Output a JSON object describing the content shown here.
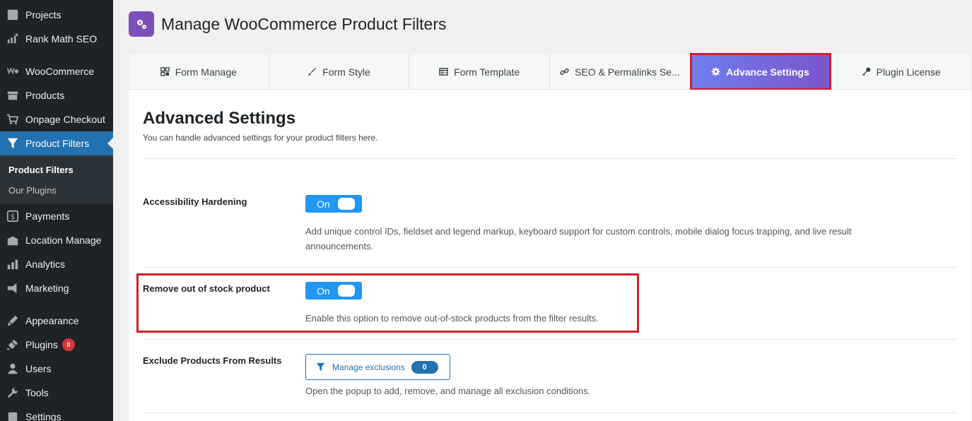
{
  "sidebar": {
    "items": [
      {
        "label": "Projects",
        "icon": "projects-icon"
      },
      {
        "label": "Rank Math SEO",
        "icon": "rank-math-icon"
      },
      {
        "label": "WooCommerce",
        "icon": "woocommerce-icon"
      },
      {
        "label": "Products",
        "icon": "products-icon"
      },
      {
        "label": "Onpage Checkout",
        "icon": "cart-icon"
      },
      {
        "label": "Product Filters",
        "icon": "filter-icon"
      },
      {
        "label": "Payments",
        "icon": "payments-icon"
      },
      {
        "label": "Location Manage",
        "icon": "location-icon"
      },
      {
        "label": "Analytics",
        "icon": "analytics-icon"
      },
      {
        "label": "Marketing",
        "icon": "marketing-icon"
      },
      {
        "label": "Appearance",
        "icon": "appearance-icon"
      },
      {
        "label": "Plugins",
        "icon": "plugins-icon"
      },
      {
        "label": "Users",
        "icon": "users-icon"
      },
      {
        "label": "Tools",
        "icon": "tools-icon"
      },
      {
        "label": "Settings",
        "icon": "settings-icon"
      }
    ],
    "submenu": [
      "Product Filters",
      "Our Plugins"
    ],
    "plugins_badge": "8"
  },
  "header": {
    "title": "Manage WooCommerce Product Filters"
  },
  "tabs": [
    {
      "label": "Form Manage",
      "icon": "grid-icon"
    },
    {
      "label": "Form Style",
      "icon": "brush-icon"
    },
    {
      "label": "Form Template",
      "icon": "table-icon"
    },
    {
      "label": "SEO & Permalinks Se...",
      "icon": "link-icon"
    },
    {
      "label": "Advance Settings",
      "icon": "gear-icon"
    },
    {
      "label": "Plugin License",
      "icon": "key-icon"
    }
  ],
  "main": {
    "title": "Advanced Settings",
    "description": "You can handle advanced settings for your product filters here.",
    "settings": [
      {
        "label": "Accessibility Hardening",
        "toggle": "On",
        "help": "Add unique control IDs, fieldset and legend markup, keyboard support for custom controls, mobile dialog focus trapping, and live result announcements."
      },
      {
        "label": "Remove out of stock product",
        "toggle": "On",
        "help": "Enable this option to remove out-of-stock products from the filter results."
      },
      {
        "label": "Exclude Products From Results",
        "button_label": "Manage exclusions",
        "button_count": "0",
        "help": "Open the popup to add, remove, and manage all exclusion conditions."
      }
    ]
  },
  "colors": {
    "sidebar_bg": "#1d2327",
    "active_menu": "#2271b1",
    "toggle_on": "#2196f3",
    "highlight": "#d0202a",
    "tab_gradient_start": "#6e7ef0",
    "tab_gradient_end": "#7b55c9"
  }
}
